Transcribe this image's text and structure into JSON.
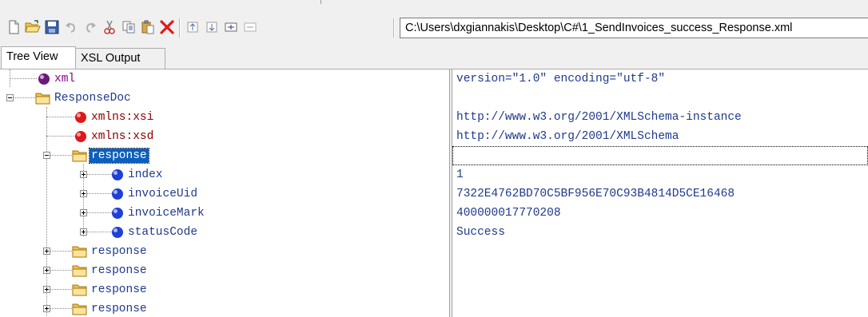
{
  "toolbar": {
    "buttons": [
      {
        "name": "new-file-icon"
      },
      {
        "name": "open-folder-icon"
      },
      {
        "name": "save-icon"
      },
      {
        "name": "undo-icon"
      },
      {
        "name": "redo-icon"
      },
      {
        "name": "cut-icon"
      },
      {
        "name": "copy-icon"
      },
      {
        "name": "paste-icon"
      },
      {
        "name": "delete-icon"
      },
      {
        "name": "collapse-node-icon"
      },
      {
        "name": "expand-node-icon"
      },
      {
        "name": "expand-all-icon"
      },
      {
        "name": "collapse-all-icon"
      }
    ],
    "path": "C:\\Users\\dxgiannakis\\Desktop\\C#\\1_SendInvoices_success_Response.xml"
  },
  "tabs": [
    {
      "label": "Tree View",
      "active": true
    },
    {
      "label": "XSL Output",
      "active": false
    }
  ],
  "tree": {
    "nodes": [
      {
        "label": "xml",
        "kind": "processing-instruction",
        "icon": "purple-ball-icon",
        "value": "version=\"1.0\" encoding=\"utf-8\""
      },
      {
        "label": "ResponseDoc",
        "kind": "element",
        "icon": "folder-icon",
        "expander": "minus",
        "value": ""
      },
      {
        "label": "xmlns:xsi",
        "kind": "attribute",
        "icon": "red-ball-icon",
        "value": "http://www.w3.org/2001/XMLSchema-instance"
      },
      {
        "label": "xmlns:xsd",
        "kind": "attribute",
        "icon": "red-ball-icon",
        "value": "http://www.w3.org/2001/XMLSchema"
      },
      {
        "label": "response",
        "kind": "element",
        "icon": "folder-icon",
        "expander": "minus",
        "selected": true,
        "value": ""
      },
      {
        "label": "index",
        "kind": "element",
        "icon": "blue-ball-icon",
        "expander": "plus",
        "value": "1"
      },
      {
        "label": "invoiceUid",
        "kind": "element",
        "icon": "blue-ball-icon",
        "expander": "plus",
        "value": "7322E4762BD70C5BF956E70C93B4814D5CE16468"
      },
      {
        "label": "invoiceMark",
        "kind": "element",
        "icon": "blue-ball-icon",
        "expander": "plus",
        "value": "400000017770208"
      },
      {
        "label": "statusCode",
        "kind": "element",
        "icon": "blue-ball-icon",
        "expander": "plus",
        "value": "Success"
      },
      {
        "label": "response",
        "kind": "element",
        "icon": "folder-icon",
        "expander": "plus",
        "value": ""
      },
      {
        "label": "response",
        "kind": "element",
        "icon": "folder-icon",
        "expander": "plus",
        "value": ""
      },
      {
        "label": "response",
        "kind": "element",
        "icon": "folder-icon",
        "expander": "plus",
        "value": ""
      },
      {
        "label": "response",
        "kind": "element",
        "icon": "folder-icon",
        "expander": "plus",
        "value": ""
      }
    ]
  },
  "colors": {
    "processing_instruction": "#8b008b",
    "element": "#1f3a8a",
    "attribute": "#8b0000",
    "selection": "#0a5fbf",
    "value_text": "#1f3a8a"
  }
}
